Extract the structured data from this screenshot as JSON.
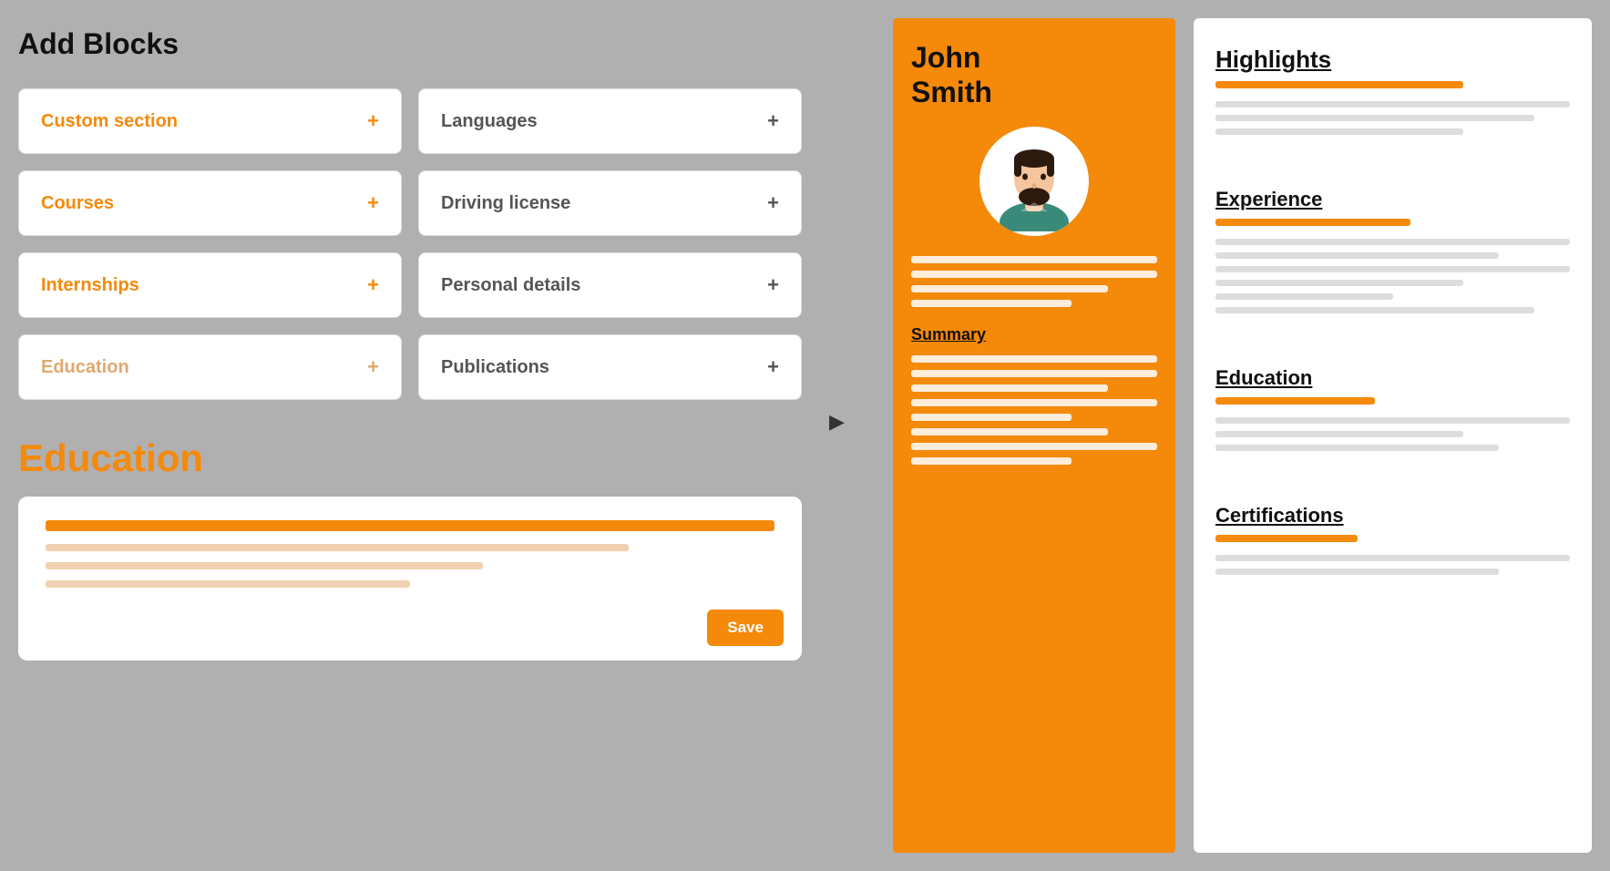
{
  "leftPanel": {
    "title": "Add Blocks",
    "blocks": [
      {
        "id": "custom-section",
        "label": "Custom section",
        "style": "orange",
        "plus": "+"
      },
      {
        "id": "languages",
        "label": "Languages",
        "style": "dark",
        "plus": "+"
      },
      {
        "id": "courses",
        "label": "Courses",
        "style": "orange",
        "plus": "+"
      },
      {
        "id": "driving-license",
        "label": "Driving license",
        "style": "dark",
        "plus": "+"
      },
      {
        "id": "internships",
        "label": "Internships",
        "style": "orange",
        "plus": "+"
      },
      {
        "id": "personal-details",
        "label": "Personal details",
        "style": "dark",
        "plus": "+"
      },
      {
        "id": "education",
        "label": "Education",
        "style": "faded",
        "plus": "+"
      },
      {
        "id": "publications",
        "label": "Publications",
        "style": "dark",
        "plus": "+"
      }
    ]
  },
  "educationSection": {
    "heading": "Education",
    "saveLabel": "Save"
  },
  "resumePreview": {
    "name": "John\nSmith",
    "summaryLabel": "Summary"
  },
  "rightPanel": {
    "highlightsTitle": "Highlights",
    "sections": [
      {
        "id": "experience",
        "label": "Experience"
      },
      {
        "id": "education",
        "label": "Education"
      },
      {
        "id": "certifications",
        "label": "Certifications"
      }
    ]
  }
}
